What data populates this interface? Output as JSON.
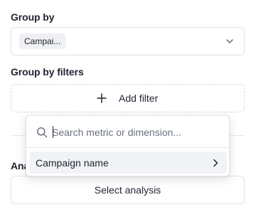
{
  "group_by": {
    "label": "Group by",
    "selected_chip": "Campai...",
    "dropdown_icon": "chevron-down-icon"
  },
  "group_by_filters": {
    "label": "Group by filters",
    "add_filter_label": "Add filter",
    "add_icon": "plus-icon"
  },
  "filter_menu": {
    "search_placeholder": "Search metric or dimension...",
    "search_value": "",
    "search_icon": "search-icon",
    "options": [
      {
        "label": "Campaign name",
        "icon": "chevron-right-icon"
      }
    ]
  },
  "analysis": {
    "label": "Analysis",
    "select_label": "Select analysis"
  },
  "colors": {
    "text": "#1f2430",
    "border": "#dfe2e7",
    "chip_bg": "#eef0f3",
    "option_hover_bg": "#f1f3f6",
    "placeholder": "#6b7280"
  }
}
